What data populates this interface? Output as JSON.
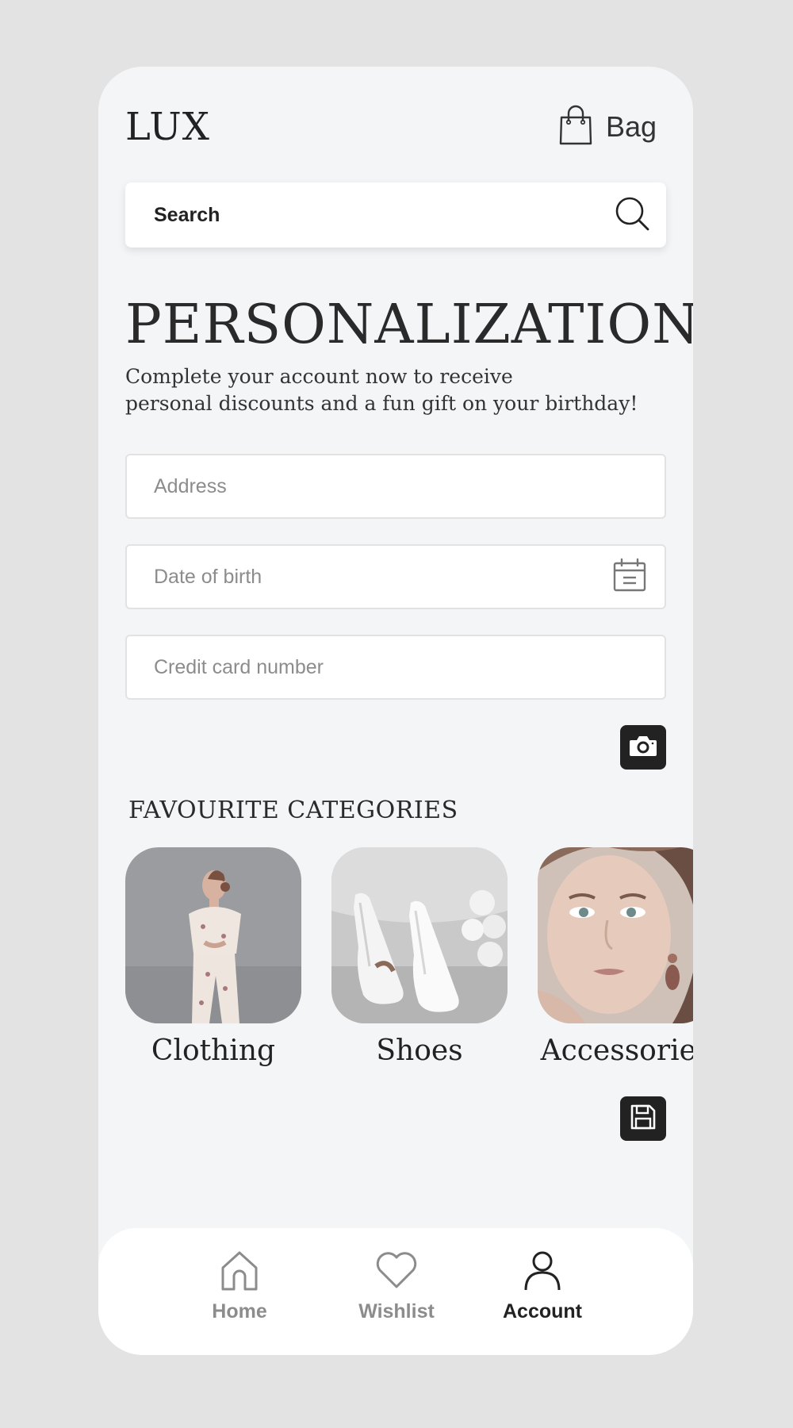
{
  "header": {
    "logo": "LUX",
    "bag_label": "Bag"
  },
  "search": {
    "placeholder": "Search"
  },
  "personalization": {
    "title": "PERSONALIZATION",
    "subtitle_line1": "Complete your account now to receive",
    "subtitle_line2": "personal discounts and a fun gift on your birthday!"
  },
  "form": {
    "address_placeholder": "Address",
    "dob_placeholder": "Date of birth",
    "card_placeholder": "Credit card number"
  },
  "categories": {
    "title": "FAVOURITE CATEGORIES",
    "items": [
      {
        "label": "Clothing"
      },
      {
        "label": "Shoes"
      },
      {
        "label": "Accessories"
      }
    ]
  },
  "nav": {
    "items": [
      {
        "label": "Home",
        "icon": "home-icon",
        "active": false
      },
      {
        "label": "Wishlist",
        "icon": "heart-icon",
        "active": false
      },
      {
        "label": "Account",
        "icon": "user-icon",
        "active": true
      }
    ]
  },
  "colors": {
    "background": "#e3e3e3",
    "screen": "#f4f5f7",
    "accent_dark": "#222222",
    "muted": "#8c8c8c"
  }
}
